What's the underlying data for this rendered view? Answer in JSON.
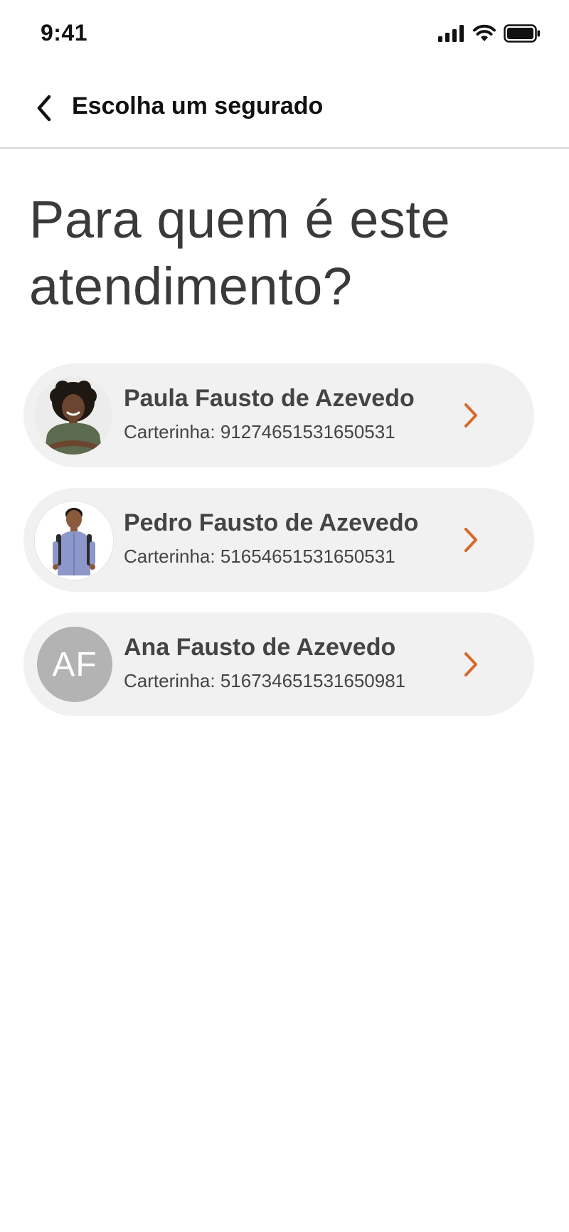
{
  "status_bar": {
    "time": "9:41",
    "icons": [
      "signal-icon",
      "wifi-icon",
      "battery-icon"
    ]
  },
  "header": {
    "back_icon": "chevron-left-icon",
    "title": "Escolha um segurado"
  },
  "main": {
    "title": "Para quem é este atendimento?"
  },
  "insured": [
    {
      "name": "Paula Fausto de Azevedo",
      "card": "Carterinha: 91274651531650531",
      "avatar": "photo"
    },
    {
      "name": "Pedro Fausto de Azevedo",
      "card": "Carterinha: 51654651531650531",
      "avatar": "photo"
    },
    {
      "name": "Ana Fausto de Azevedo",
      "card": "Carterinha: 516734651531650981",
      "avatar": "initials",
      "initials": "AF"
    }
  ],
  "colors": {
    "accent": "#d9692a",
    "card_bg": "#f1f1f1",
    "initials_bg": "#b3b3b3"
  }
}
